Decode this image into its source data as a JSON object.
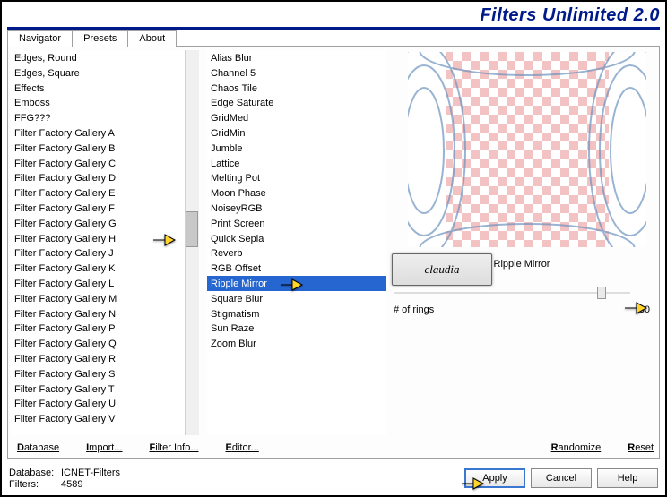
{
  "app_title": "Filters Unlimited 2.0",
  "tabs": {
    "navigator": "Navigator",
    "presets": "Presets",
    "about": "About",
    "active": "navigator"
  },
  "col1_items": [
    "Edges, Round",
    "Edges, Square",
    "Effects",
    "Emboss",
    "FFG???",
    "Filter Factory Gallery A",
    "Filter Factory Gallery B",
    "Filter Factory Gallery C",
    "Filter Factory Gallery D",
    "Filter Factory Gallery E",
    "Filter Factory Gallery F",
    "Filter Factory Gallery G",
    "Filter Factory Gallery H",
    "Filter Factory Gallery J",
    "Filter Factory Gallery K",
    "Filter Factory Gallery L",
    "Filter Factory Gallery M",
    "Filter Factory Gallery N",
    "Filter Factory Gallery P",
    "Filter Factory Gallery Q",
    "Filter Factory Gallery R",
    "Filter Factory Gallery S",
    "Filter Factory Gallery T",
    "Filter Factory Gallery U",
    "Filter Factory Gallery V"
  ],
  "col1_selected_index": 12,
  "col2_items": [
    "Alias Blur",
    "Channel 5",
    "Chaos Tile",
    "Edge Saturate",
    "GridMed",
    "GridMin",
    "Jumble",
    "Lattice",
    "Melting Pot",
    "Moon Phase",
    "NoiseyRGB",
    "Print Screen",
    "Quick Sepia",
    "Reverb",
    "RGB Offset",
    "Ripple Mirror",
    "Square Blur",
    "Stigmatism",
    "Sun Raze",
    "Zoom Blur"
  ],
  "col2_selected_index": 15,
  "filter_name": "Ripple Mirror",
  "param": {
    "label": "# of rings",
    "value": "80"
  },
  "watermark_text": "claudia",
  "bottom_links": {
    "database": "Database",
    "import": "Import...",
    "filterinfo": "Filter Info...",
    "editor": "Editor...",
    "randomize": "Randomize",
    "reset": "Reset"
  },
  "footer": {
    "db_label": "Database:",
    "db_value": "ICNET-Filters",
    "filters_label": "Filters:",
    "filters_value": "4589"
  },
  "buttons": {
    "apply": "Apply",
    "cancel": "Cancel",
    "help": "Help"
  }
}
